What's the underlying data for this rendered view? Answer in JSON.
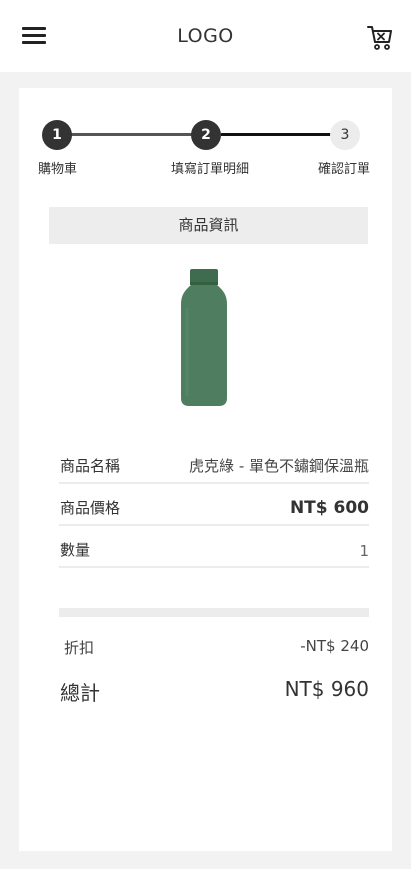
{
  "header": {
    "logo": "LOGO",
    "menu_icon": "hamburger-menu-icon",
    "cart_icon": "shopping-cart-icon"
  },
  "stepper": {
    "steps": [
      {
        "number": "1",
        "label": "購物車",
        "state": "completed"
      },
      {
        "number": "2",
        "label": "填寫訂單明細",
        "state": "current"
      },
      {
        "number": "3",
        "label": "確認訂單",
        "state": "upcoming"
      }
    ]
  },
  "product": {
    "section_title": "商品資訊",
    "image_icon": "green-water-bottle-image",
    "name_label": "商品名稱",
    "name_value": "虎克綠 - 單色不鏽鋼保溫瓶",
    "price_label": "商品價格",
    "price_value": "NT$ 600",
    "quantity_label": "數量",
    "quantity_value": "1"
  },
  "summary": {
    "discount_label": "折扣",
    "discount_value": "-NT$ 240",
    "total_label": "總計",
    "total_value": "NT$ 960"
  },
  "colors": {
    "accent": "#333333",
    "bottle": "#4f7d5f",
    "background": "#f2f2f2"
  }
}
